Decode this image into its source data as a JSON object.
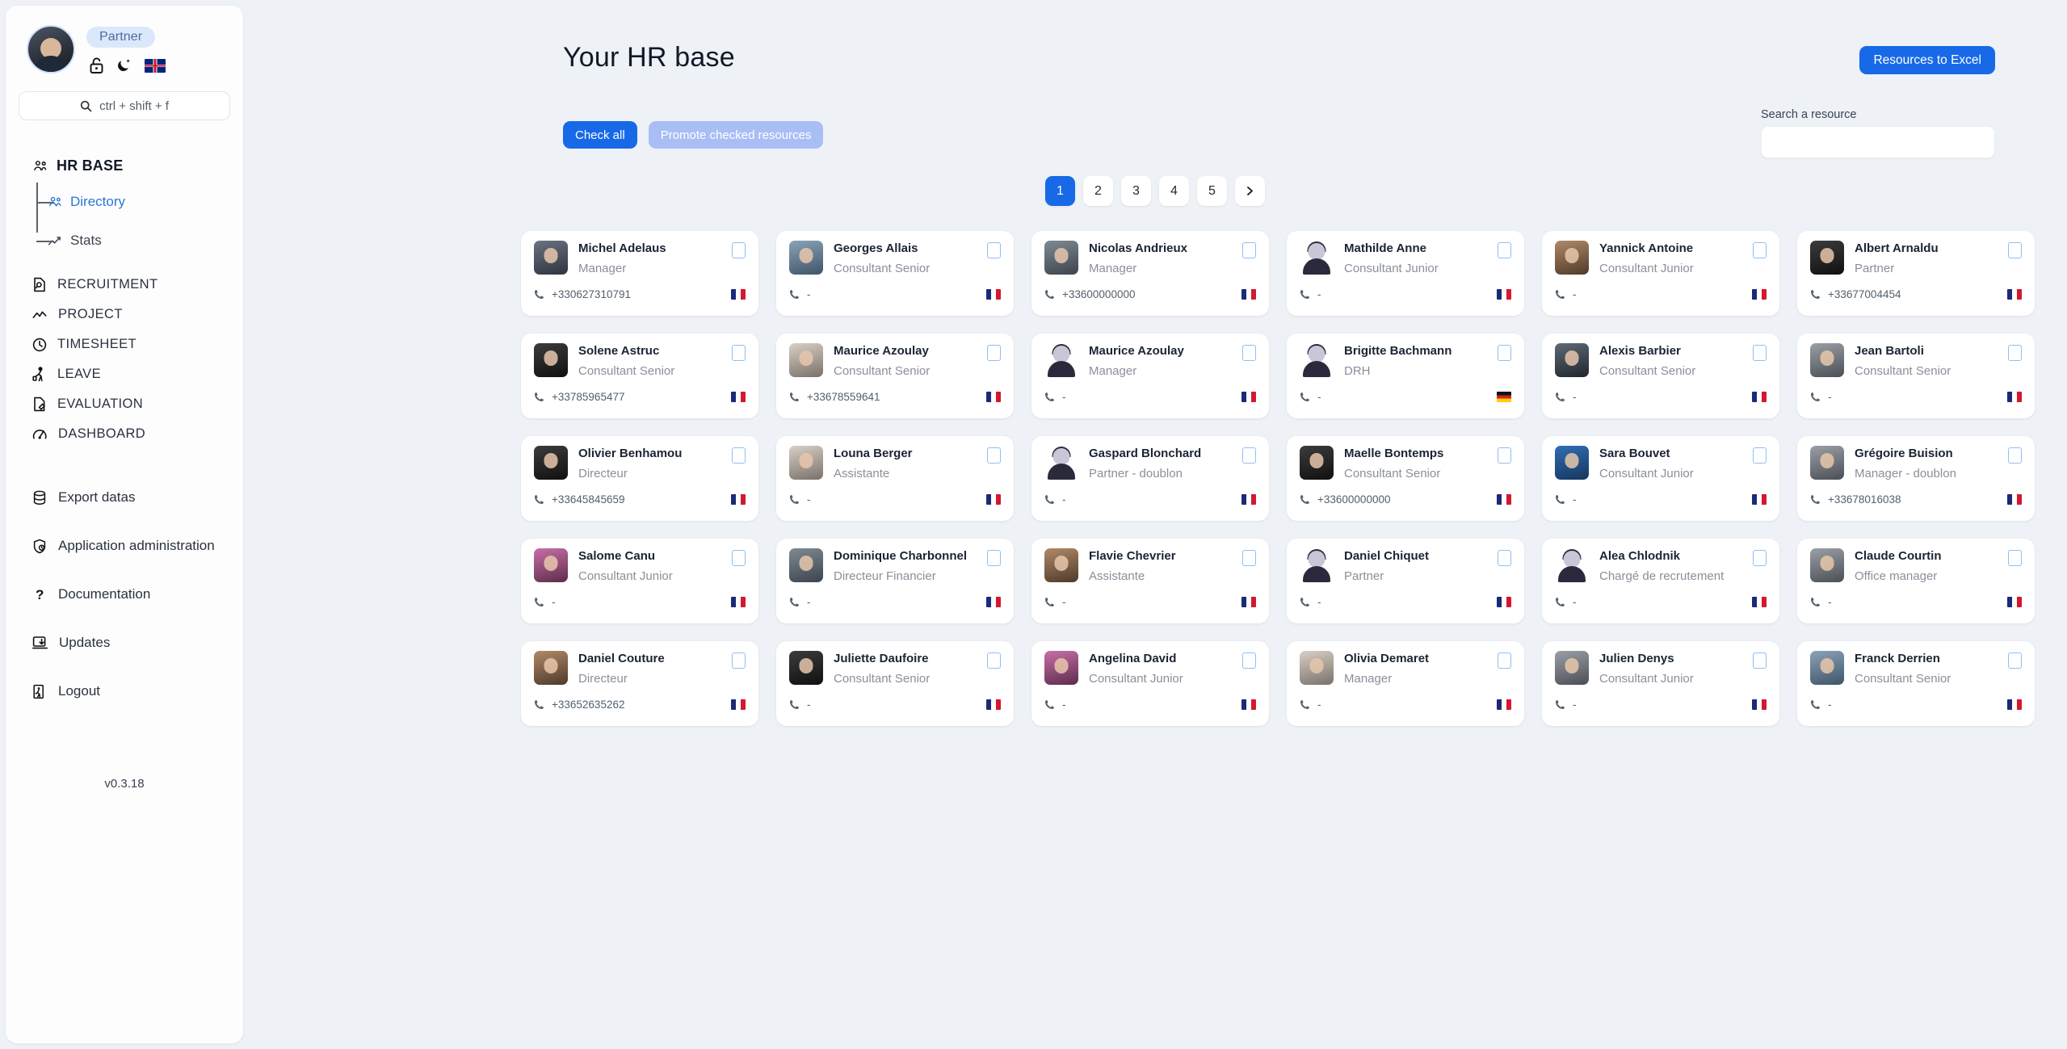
{
  "sidebar": {
    "role_badge": "Partner",
    "icons": [
      {
        "name": "unlock-icon"
      },
      {
        "name": "dark-mode-moon-icon"
      },
      {
        "name": "language-flag-uk-icon"
      }
    ],
    "search_placeholder": "ctrl + shift + f",
    "group": {
      "title": "HR BASE",
      "sub_items": [
        {
          "label": "Directory",
          "active": true,
          "icon": "people-icon"
        },
        {
          "label": "Stats",
          "active": false,
          "icon": "chart-line-icon"
        }
      ]
    },
    "nav_items": [
      {
        "label": "RECRUITMENT",
        "icon": "document-search-icon"
      },
      {
        "label": "PROJECT",
        "icon": "trend-line-icon"
      },
      {
        "label": "TIMESHEET",
        "icon": "clock-icon"
      },
      {
        "label": "LEAVE",
        "icon": "traveler-icon"
      },
      {
        "label": "EVALUATION",
        "icon": "document-edit-icon"
      },
      {
        "label": "DASHBOARD",
        "icon": "gauge-icon"
      }
    ],
    "util_items": [
      {
        "label": "Export datas",
        "icon": "database-icon"
      },
      {
        "label": "Application administration",
        "icon": "shield-lock-icon"
      },
      {
        "label": "Documentation",
        "icon": "question-mark-icon"
      },
      {
        "label": "Updates",
        "icon": "download-screen-icon"
      },
      {
        "label": "Logout",
        "icon": "exit-door-icon"
      }
    ],
    "version": "v0.3.18"
  },
  "header": {
    "title": "Your HR base",
    "excel_button": "Resources to Excel"
  },
  "toolbar": {
    "check_all": "Check all",
    "promote": "Promote checked resources"
  },
  "search": {
    "label": "Search a resource",
    "value": "",
    "placeholder": ""
  },
  "pagination": {
    "pages": [
      "1",
      "2",
      "3",
      "4",
      "5"
    ],
    "active": "1",
    "next_label": "›"
  },
  "colors": {
    "accent": "#1769e8",
    "accent_muted": "#a9bef5",
    "page_bg": "#eef1f6",
    "card_bg": "#ffffff",
    "link": "#2a77d4"
  },
  "resources": [
    {
      "name": "Michel Adelaus",
      "role": "Manager",
      "phone": "+330627310791",
      "flag": "fr",
      "photo": "ph-a",
      "checked": false
    },
    {
      "name": "Georges Allais",
      "role": "Consultant Senior",
      "phone": "-",
      "flag": "fr",
      "photo": "ph-b",
      "checked": false
    },
    {
      "name": "Nicolas Andrieux",
      "role": "Manager",
      "phone": "+33600000000",
      "flag": "fr",
      "photo": "ph-c",
      "checked": false
    },
    {
      "name": "Mathilde Anne",
      "role": "Consultant Junior",
      "phone": "-",
      "flag": "fr",
      "photo": "placeholder",
      "checked": false
    },
    {
      "name": "Yannick Antoine",
      "role": "Consultant Junior",
      "phone": "-",
      "flag": "fr",
      "photo": "ph-e",
      "checked": false
    },
    {
      "name": "Albert Arnaldu",
      "role": "Partner",
      "phone": "+33677004454",
      "flag": "fr",
      "photo": "ph-j",
      "checked": false
    },
    {
      "name": "Solene Astruc",
      "role": "Consultant Senior",
      "phone": "+33785965477",
      "flag": "fr",
      "photo": "ph-j",
      "checked": false
    },
    {
      "name": "Maurice Azoulay",
      "role": "Consultant Senior",
      "phone": "+33678559641",
      "flag": "fr",
      "photo": "ph-i",
      "checked": false
    },
    {
      "name": "Maurice Azoulay",
      "role": "Manager",
      "phone": "-",
      "flag": "fr",
      "photo": "placeholder",
      "checked": false
    },
    {
      "name": "Brigitte Bachmann",
      "role": "DRH",
      "phone": "-",
      "flag": "de",
      "photo": "placeholder",
      "checked": false
    },
    {
      "name": "Alexis Barbier",
      "role": "Consultant Senior",
      "phone": "-",
      "flag": "fr",
      "photo": "ph-h",
      "checked": false
    },
    {
      "name": "Jean Bartoli",
      "role": "Consultant Senior",
      "phone": "-",
      "flag": "fr",
      "photo": "ph-d",
      "checked": false
    },
    {
      "name": "Olivier Benhamou",
      "role": "Directeur",
      "phone": "+33645845659",
      "flag": "fr",
      "photo": "ph-j",
      "checked": false
    },
    {
      "name": "Louna Berger",
      "role": "Assistante",
      "phone": "-",
      "flag": "fr",
      "photo": "ph-i",
      "checked": false
    },
    {
      "name": "Gaspard Blonchard",
      "role": "Partner - doublon",
      "phone": "-",
      "flag": "fr",
      "photo": "placeholder",
      "checked": false
    },
    {
      "name": "Maelle Bontemps",
      "role": "Consultant Senior",
      "phone": "+33600000000",
      "flag": "fr",
      "photo": "ph-j",
      "checked": false
    },
    {
      "name": "Sara Bouvet",
      "role": "Consultant Junior",
      "phone": "-",
      "flag": "fr",
      "photo": "ph-f",
      "checked": false
    },
    {
      "name": "Grégoire Buision",
      "role": "Manager - doublon",
      "phone": "+33678016038",
      "flag": "fr",
      "photo": "ph-d",
      "checked": false
    },
    {
      "name": "Salome Canu",
      "role": "Consultant Junior",
      "phone": "-",
      "flag": "fr",
      "photo": "ph-g",
      "checked": false
    },
    {
      "name": "Dominique Charbonnel",
      "role": "Directeur Financier",
      "phone": "-",
      "flag": "fr",
      "photo": "ph-c",
      "checked": false
    },
    {
      "name": "Flavie Chevrier",
      "role": "Assistante",
      "phone": "-",
      "flag": "fr",
      "photo": "ph-e",
      "checked": false
    },
    {
      "name": "Daniel Chiquet",
      "role": "Partner",
      "phone": "-",
      "flag": "fr",
      "photo": "placeholder",
      "checked": false
    },
    {
      "name": "Alea Chlodnik",
      "role": "Chargé de recrutement",
      "phone": "-",
      "flag": "fr",
      "photo": "placeholder",
      "checked": false
    },
    {
      "name": "Claude Courtin",
      "role": "Office manager",
      "phone": "-",
      "flag": "fr",
      "photo": "ph-d",
      "checked": false
    },
    {
      "name": "Daniel Couture",
      "role": "Directeur",
      "phone": "+33652635262",
      "flag": "fr",
      "photo": "ph-e",
      "checked": false
    },
    {
      "name": "Juliette Daufoire",
      "role": "Consultant Senior",
      "phone": "-",
      "flag": "fr",
      "photo": "ph-j",
      "checked": false
    },
    {
      "name": "Angelina David",
      "role": "Consultant Junior",
      "phone": "-",
      "flag": "fr",
      "photo": "ph-g",
      "checked": false
    },
    {
      "name": "Olivia Demaret",
      "role": "Manager",
      "phone": "-",
      "flag": "fr",
      "photo": "ph-i",
      "checked": false
    },
    {
      "name": "Julien Denys",
      "role": "Consultant Junior",
      "phone": "-",
      "flag": "fr",
      "photo": "ph-d",
      "checked": false
    },
    {
      "name": "Franck Derrien",
      "role": "Consultant Senior",
      "phone": "-",
      "flag": "fr",
      "photo": "ph-b",
      "checked": false
    }
  ]
}
